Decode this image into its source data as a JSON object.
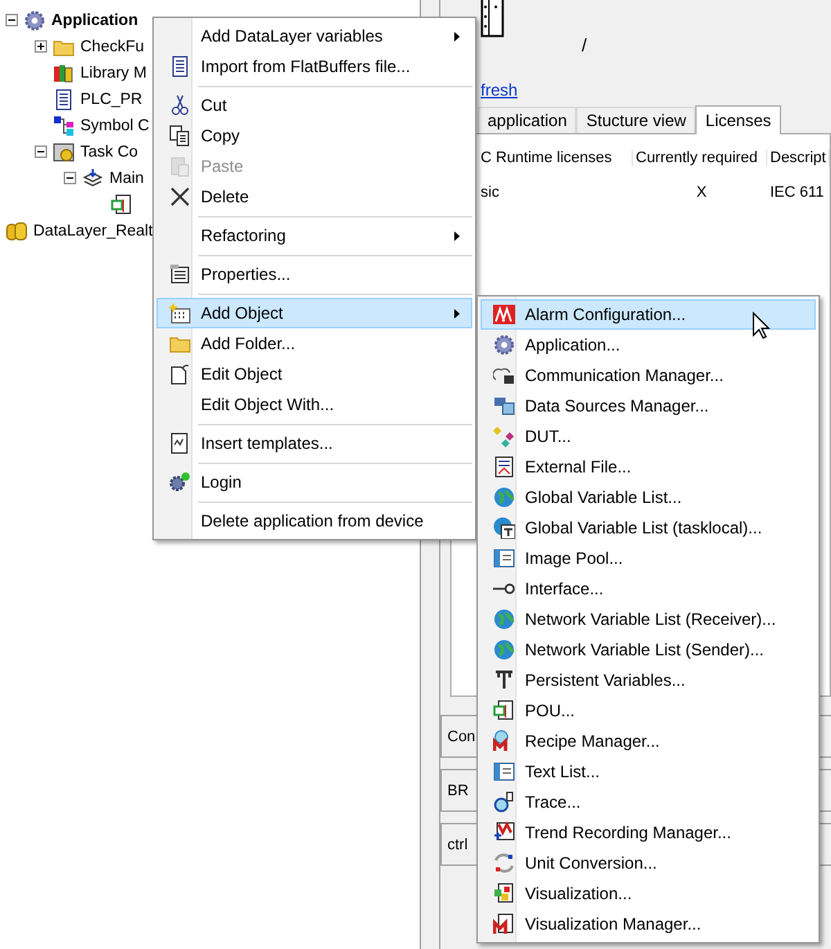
{
  "tree": [
    {
      "label": "Application",
      "kind": "application",
      "active": true,
      "expanded": true,
      "children": [
        {
          "label": "CheckFu",
          "kind": "folder",
          "active": false,
          "expanded": false
        },
        {
          "label": "Library M",
          "kind": "library",
          "active": false
        },
        {
          "label": "PLC_PR",
          "kind": "document",
          "active": false
        },
        {
          "label": "Symbol C",
          "kind": "symbols",
          "active": false
        },
        {
          "label": "Task Co",
          "kind": "tasks",
          "active": false,
          "expanded": true,
          "children": [
            {
              "label": "Main",
              "kind": "task",
              "active": false,
              "expanded": true,
              "children": [
                {
                  "kind": "pou"
                }
              ]
            }
          ]
        }
      ]
    },
    {
      "label": "DataLayer_Realt",
      "kind": "datalayer",
      "active": false
    }
  ],
  "device": {
    "path": "/",
    "refresh_link": "fresh"
  },
  "tabs": [
    {
      "label": "application",
      "selected": false
    },
    {
      "label": "Stucture view",
      "selected": false
    },
    {
      "label": "Licenses",
      "selected": true
    }
  ],
  "table": {
    "columns": [
      "C Runtime licenses",
      "Currently required",
      "Descript"
    ],
    "rows": [
      [
        "sic",
        "X",
        "IEC 611"
      ]
    ]
  },
  "panels": [
    "Con",
    "BR",
    "ctrl"
  ],
  "context_menu": [
    {
      "kind": "item",
      "label": "Add DataLayer variables",
      "submenu": true,
      "disabled": false,
      "selected": false
    },
    {
      "kind": "item",
      "label": "Import from FlatBuffers file...",
      "submenu": false,
      "disabled": false,
      "selected": false
    },
    {
      "kind": "separator"
    },
    {
      "kind": "item",
      "label": "Cut",
      "submenu": false,
      "disabled": false,
      "selected": false
    },
    {
      "kind": "item",
      "label": "Copy",
      "submenu": false,
      "disabled": false,
      "selected": false
    },
    {
      "kind": "item",
      "label": "Paste",
      "submenu": false,
      "disabled": true,
      "selected": false
    },
    {
      "kind": "item",
      "label": "Delete",
      "submenu": false,
      "disabled": false,
      "selected": false
    },
    {
      "kind": "separator"
    },
    {
      "kind": "item",
      "label": "Refactoring",
      "submenu": true,
      "disabled": false,
      "selected": false
    },
    {
      "kind": "separator"
    },
    {
      "kind": "item",
      "label": "Properties...",
      "submenu": false,
      "disabled": false,
      "selected": false
    },
    {
      "kind": "separator"
    },
    {
      "kind": "item",
      "label": "Add Object",
      "submenu": true,
      "disabled": false,
      "selected": true
    },
    {
      "kind": "item",
      "label": "Add Folder...",
      "submenu": false,
      "disabled": false,
      "selected": false
    },
    {
      "kind": "item",
      "label": "Edit Object",
      "submenu": false,
      "disabled": false,
      "selected": false
    },
    {
      "kind": "item",
      "label": "Edit Object With...",
      "submenu": false,
      "disabled": false,
      "selected": false
    },
    {
      "kind": "separator"
    },
    {
      "kind": "item",
      "label": "Insert templates...",
      "submenu": false,
      "disabled": false,
      "selected": false
    },
    {
      "kind": "separator"
    },
    {
      "kind": "item",
      "label": "Login",
      "submenu": false,
      "disabled": false,
      "selected": false
    },
    {
      "kind": "separator"
    },
    {
      "kind": "item",
      "label": "Delete application from device",
      "submenu": false,
      "disabled": false,
      "selected": false
    }
  ],
  "submenu": [
    {
      "kind": "item",
      "label": "Alarm Configuration...",
      "selected": true
    },
    {
      "kind": "item",
      "label": "Application...",
      "selected": false
    },
    {
      "kind": "item",
      "label": "Communication Manager...",
      "selected": false
    },
    {
      "kind": "item",
      "label": "Data Sources Manager...",
      "selected": false
    },
    {
      "kind": "item",
      "label": "DUT...",
      "selected": false
    },
    {
      "kind": "item",
      "label": "External File...",
      "selected": false
    },
    {
      "kind": "item",
      "label": "Global Variable List...",
      "selected": false
    },
    {
      "kind": "item",
      "label": "Global Variable List (tasklocal)...",
      "selected": false
    },
    {
      "kind": "item",
      "label": "Image Pool...",
      "selected": false
    },
    {
      "kind": "item",
      "label": "Interface...",
      "selected": false
    },
    {
      "kind": "item",
      "label": "Network Variable List (Receiver)...",
      "selected": false
    },
    {
      "kind": "item",
      "label": "Network Variable List (Sender)...",
      "selected": false
    },
    {
      "kind": "item",
      "label": "Persistent Variables...",
      "selected": false
    },
    {
      "kind": "item",
      "label": "POU...",
      "selected": false
    },
    {
      "kind": "item",
      "label": "Recipe Manager...",
      "selected": false
    },
    {
      "kind": "item",
      "label": "Text List...",
      "selected": false
    },
    {
      "kind": "item",
      "label": "Trace...",
      "selected": false
    },
    {
      "kind": "item",
      "label": "Trend Recording Manager...",
      "selected": false
    },
    {
      "kind": "item",
      "label": "Unit Conversion...",
      "selected": false
    },
    {
      "kind": "item",
      "label": "Visualization...",
      "selected": false
    },
    {
      "kind": "item",
      "label": "Visualization Manager...",
      "selected": false
    }
  ]
}
